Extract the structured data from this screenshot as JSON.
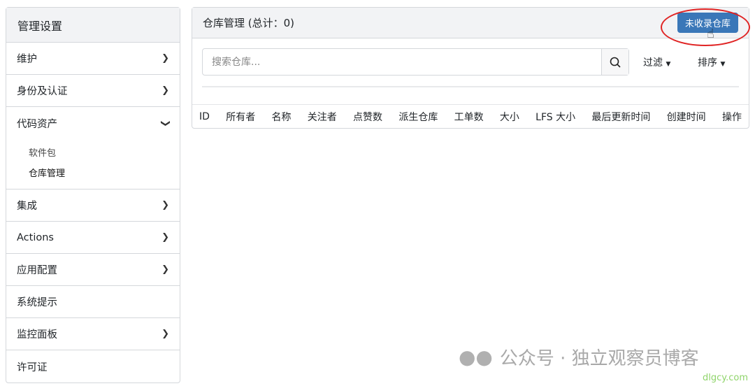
{
  "sidebar": {
    "title": "管理设置",
    "items": [
      {
        "label": "维护",
        "chevron": "right"
      },
      {
        "label": "身份及认证",
        "chevron": "right"
      },
      {
        "label": "代码资产",
        "chevron": "down",
        "sub": [
          "软件包",
          "仓库管理"
        ]
      },
      {
        "label": "集成",
        "chevron": "right"
      },
      {
        "label": "Actions",
        "chevron": "right"
      },
      {
        "label": "应用配置",
        "chevron": "right"
      },
      {
        "label": "系统提示"
      },
      {
        "label": "监控面板",
        "chevron": "right"
      },
      {
        "label": "许可证"
      }
    ]
  },
  "main": {
    "title": "仓库管理 (总计：0)",
    "unadopted_button": "未收录仓库",
    "search_placeholder": "搜索仓库...",
    "filter": "过滤",
    "sort": "排序",
    "columns": [
      "ID",
      "所有者",
      "名称",
      "关注者",
      "点赞数",
      "派生仓库",
      "工单数",
      "大小",
      "LFS 大小",
      "最后更新时间",
      "创建时间",
      "操作"
    ]
  },
  "watermark": {
    "text": "公众号 · 独立观察员博客",
    "site": "dlgcy.com"
  }
}
